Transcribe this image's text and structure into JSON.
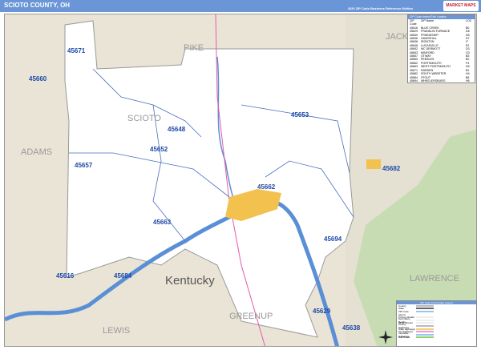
{
  "header": {
    "title": "SCIOTO COUNTY, OH",
    "edition": "2020 ZIP Code Business Reference Edition",
    "logo": "MARKET MAPS"
  },
  "map": {
    "region_labels": [
      {
        "text": "PIKE",
        "id": "pike"
      },
      {
        "text": "JACKSON",
        "id": "jackson"
      },
      {
        "text": "ADAMS",
        "id": "adams"
      },
      {
        "text": "SCIOTO",
        "id": "scioto"
      },
      {
        "text": "Kentucky",
        "id": "kentucky"
      },
      {
        "text": "LAWRENCE",
        "id": "lawrence"
      },
      {
        "text": "LEWIS",
        "id": "lewis"
      },
      {
        "text": "GREENUP",
        "id": "greenup"
      }
    ],
    "zip_labels": [
      "45671",
      "45660",
      "45648",
      "45653",
      "45652",
      "45657",
      "45682",
      "45662",
      "45663",
      "45694",
      "45616",
      "45684",
      "45629",
      "45638"
    ],
    "colors": {
      "water": "#5a8fd6",
      "land": "#e9e4d6",
      "county": "#ffffff",
      "city": "#f2c14e",
      "boundary": "#4a6fc0",
      "forest": "#c8dcb4"
    }
  },
  "zip_table": {
    "title": "ZIP Code Index/Grid Locator",
    "headers": [
      "ZIP Code",
      "ZIP Name",
      "LOC"
    ],
    "rows": [
      [
        "45616",
        "BLUE CREEK",
        "B0"
      ],
      [
        "45629",
        "FRANKLIN FURNACE",
        "D6"
      ],
      [
        "45630",
        "FRIENDSHIP",
        "D5"
      ],
      [
        "45636",
        "HAVERHILL",
        "D7"
      ],
      [
        "45638",
        "IRONTON",
        "I7"
      ],
      [
        "45648",
        "LUCASVILLE",
        "E2"
      ],
      [
        "45652",
        "MC DERMOTT",
        "D3"
      ],
      [
        "45653",
        "MINFORD",
        "G3"
      ],
      [
        "45657",
        "OTWAY",
        "B3"
      ],
      [
        "45660",
        "PEEBLES",
        "B2"
      ],
      [
        "45662",
        "PORTSMOUTH",
        "F4"
      ],
      [
        "45663",
        "WEST PORTSMOUTH",
        "D5"
      ],
      [
        "45671",
        "RARDEN",
        "B1"
      ],
      [
        "45682",
        "SOUTH WEBSTER",
        "H4"
      ],
      [
        "45684",
        "STOUT",
        "B6"
      ],
      [
        "45694",
        "WHEELERSBURG",
        "H6"
      ]
    ]
  },
  "legend": {
    "title": "ZIP Code County Map Legend",
    "items": [
      "County",
      "State",
      "ZIP Code",
      "Airport",
      "Primary Roads",
      "Secondary Roads",
      "Minor Streets",
      "County Highways",
      "State Highways",
      "US Highways",
      "Interstate Highways",
      "Rail Roads"
    ]
  }
}
